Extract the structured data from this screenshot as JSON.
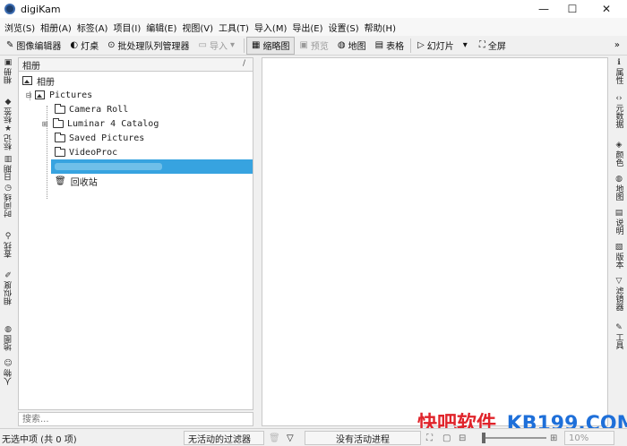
{
  "window": {
    "title": "digiKam",
    "controls": {
      "minimize": "—",
      "maximize": "☐",
      "close": "✕"
    }
  },
  "menubar": {
    "items": [
      "浏览(S)",
      "相册(A)",
      "标签(A)",
      "项目(I)",
      "编辑(E)",
      "视图(V)",
      "工具(T)",
      "导入(M)",
      "导出(E)",
      "设置(S)",
      "帮助(H)"
    ]
  },
  "toolbar": {
    "image_editor": "图像编辑器",
    "light_table": "灯桌",
    "batch_queue": "批处理队列管理器",
    "import": "导入",
    "thumbnails": "缩略图",
    "preview": "预览",
    "map": "地图",
    "table": "表格",
    "slideshow": "幻灯片",
    "fullscreen": "全屏"
  },
  "left_tabs": [
    "相册",
    "标签",
    "标记",
    "日期",
    "时间线",
    "查找",
    "相似度",
    "地图",
    "人物"
  ],
  "right_tabs": [
    "属性",
    "元数据",
    "颜色",
    "地图",
    "说明",
    "版本",
    "滤镜器",
    "工具"
  ],
  "album_panel": {
    "header": "相册",
    "edit_icon": "/",
    "search_placeholder": "搜索...",
    "tree": {
      "root": "相册",
      "pictures": "Pictures",
      "children": [
        "Camera Roll",
        "Luminar 4 Catalog",
        "Saved Pictures",
        "VideoProc"
      ],
      "trash": "回收站"
    }
  },
  "statusbar": {
    "selection": "无选中项 (共 0 项)",
    "filter": "无活动的过滤器",
    "progress": "没有活动进程",
    "zoom": "10%"
  },
  "watermark": {
    "text_cn": "快吧软件",
    "text_en": "KB199.COM"
  },
  "colors": {
    "selection": "#37a3e0",
    "watermark_red": "#e0242b",
    "watermark_blue": "#1e6fd9"
  }
}
